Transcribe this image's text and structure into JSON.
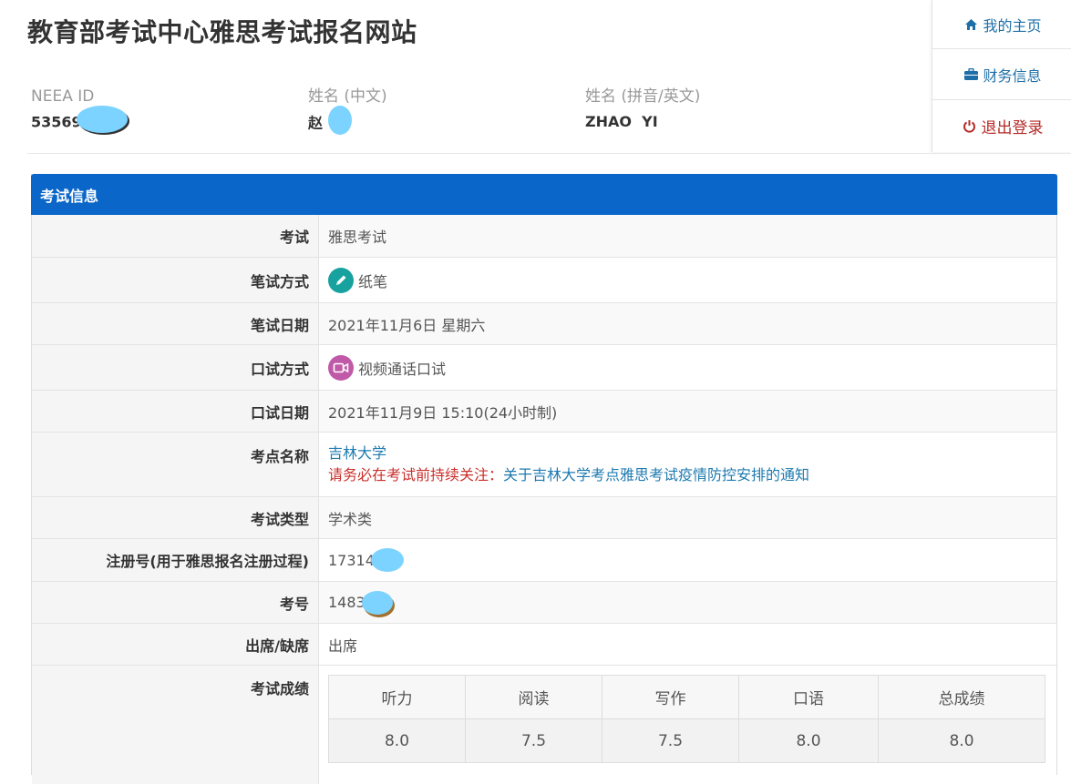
{
  "site_title": "教育部考试中心雅思考试报名网站",
  "nav": {
    "home": "我的主页",
    "finance": "财务信息",
    "logout": "退出登录"
  },
  "user": {
    "neea_id_label": "NEEA ID",
    "neea_id_value": "53569",
    "name_cn_label": "姓名 (中文)",
    "name_cn_value": "赵",
    "name_en_label": "姓名 (拼音/英文)",
    "name_en_value": "ZHAO  YI"
  },
  "panel": {
    "heading": "考试信息",
    "rows": {
      "exam": {
        "label": "考试",
        "value": "雅思考试"
      },
      "written_mode": {
        "label": "笔试方式",
        "value": "纸笔"
      },
      "written_date": {
        "label": "笔试日期",
        "value": "2021年11月6日 星期六"
      },
      "speaking_mode": {
        "label": "口试方式",
        "value": "视频通话口试"
      },
      "speaking_date": {
        "label": "口试日期",
        "value": "2021年11月9日 15:10(24小时制)"
      },
      "venue": {
        "label": "考点名称",
        "value": "吉林大学",
        "notice_prefix": "请务必在考试前持续关注：",
        "notice_link": "关于吉林大学考点雅思考试疫情防控安排的通知"
      },
      "exam_type": {
        "label": "考试类型",
        "value": "学术类"
      },
      "registration_no": {
        "label": "注册号(用于雅思报名注册过程)",
        "value": "17314"
      },
      "candidate_no": {
        "label": "考号",
        "value": "1483"
      },
      "attendance": {
        "label": "出席/缺席",
        "value": "出席"
      },
      "scores": {
        "label": "考试成绩",
        "headers": [
          "听力",
          "阅读",
          "写作",
          "口语",
          "总成绩"
        ],
        "values": [
          "8.0",
          "7.5",
          "7.5",
          "8.0",
          "8.0"
        ]
      }
    }
  },
  "colors": {
    "heading_bg": "#0a66c8",
    "link": "#1e7ab0",
    "warn": "#c9302c",
    "pen_icon": "#17a2a0",
    "video_icon": "#c05aa8",
    "redaction": "#7cd3ff"
  }
}
